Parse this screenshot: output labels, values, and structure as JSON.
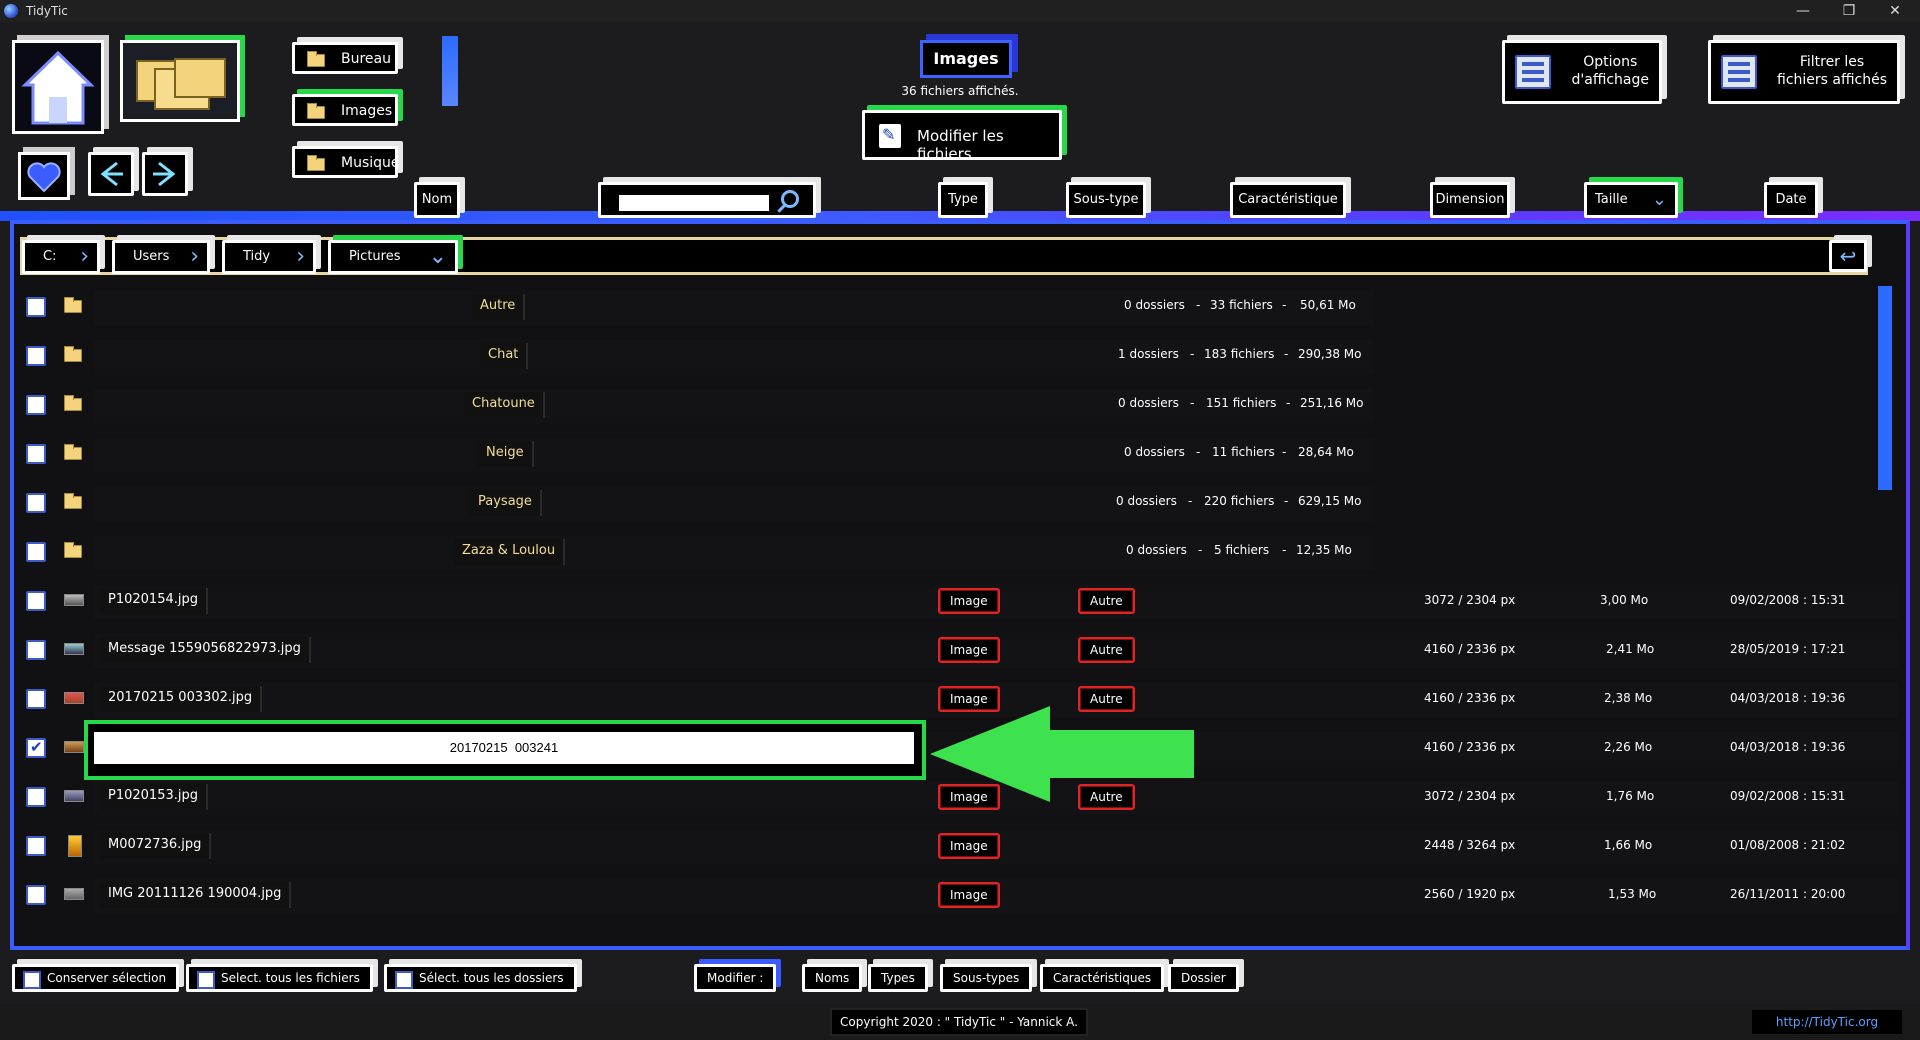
{
  "window": {
    "title": "TidyTic",
    "minimize": "—",
    "maximize": "❐",
    "close": "✕"
  },
  "nav": {
    "locations": [
      "Bureau",
      "Images",
      "Musique"
    ]
  },
  "header": {
    "title": "Images",
    "files_count": "36 fichiers affichés.",
    "modify_files": "Modifier les fichiers",
    "options_line1": "Options",
    "options_line2": "d'affichage",
    "filter_line1": "Filtrer les",
    "filter_line2": "fichiers affichés"
  },
  "columns": {
    "nom": "Nom",
    "type": "Type",
    "sous_type": "Sous-type",
    "caracteristique": "Caractéristique",
    "dimension": "Dimension",
    "taille": "Taille",
    "date": "Date",
    "search_value": ""
  },
  "breadcrumb": [
    "C:",
    "Users",
    "Tidy",
    "Pictures"
  ],
  "folders": [
    {
      "name": "Autre",
      "dossiers": "0 dossiers",
      "fichiers": "33 fichiers",
      "taille": "50,61 Mo"
    },
    {
      "name": "Chat",
      "dossiers": "1 dossiers",
      "fichiers": "183 fichiers",
      "taille": "290,38 Mo"
    },
    {
      "name": "Chatoune",
      "dossiers": "0 dossiers",
      "fichiers": "151 fichiers",
      "taille": "251,16 Mo"
    },
    {
      "name": "Neige",
      "dossiers": "0 dossiers",
      "fichiers": "11 fichiers",
      "taille": "28,64 Mo"
    },
    {
      "name": "Paysage",
      "dossiers": "0 dossiers",
      "fichiers": "220 fichiers",
      "taille": "629,15 Mo"
    },
    {
      "name": "Zaza & Loulou",
      "dossiers": "0 dossiers",
      "fichiers": "5 fichiers",
      "taille": "12,35 Mo"
    }
  ],
  "separator": "-",
  "files": [
    {
      "name": "P1020154.jpg",
      "type": "Image",
      "subtype": "Autre",
      "dimension": "3072 / 2304 px",
      "size": "3,00 Mo",
      "date": "09/02/2008 : 15:31"
    },
    {
      "name": "Message  1559056822973.jpg",
      "type": "Image",
      "subtype": "Autre",
      "dimension": "4160 / 2336 px",
      "size": "2,41 Mo",
      "date": "28/05/2019 : 17:21"
    },
    {
      "name": "20170215  003302.jpg",
      "type": "Image",
      "subtype": "Autre",
      "dimension": "4160 / 2336 px",
      "size": "2,38 Mo",
      "date": "04/03/2018 : 19:36"
    },
    {
      "name": "",
      "type": "",
      "subtype": "",
      "dimension": "4160 / 2336 px",
      "size": "2,26 Mo",
      "date": "04/03/2018 : 19:36"
    },
    {
      "name": "P1020153.jpg",
      "type": "Image",
      "subtype": "Autre",
      "dimension": "3072 / 2304 px",
      "size": "1,76 Mo",
      "date": "09/02/2008 : 15:31"
    },
    {
      "name": "M0072736.jpg",
      "type": "Image",
      "subtype": "",
      "dimension": "2448 / 3264 px",
      "size": "1,66 Mo",
      "date": "01/08/2008 : 21:02"
    },
    {
      "name": "IMG  20111126  190004.jpg",
      "type": "Image",
      "subtype": "",
      "dimension": "2560 / 1920 px",
      "size": "1,53 Mo",
      "date": "26/11/2011 : 20:00"
    }
  ],
  "edit": {
    "value": "20170215  003241"
  },
  "bottom": {
    "keep_selection": "Conserver sélection",
    "select_all_files": "Select. tous les fichiers",
    "select_all_folders": "Sélect. tous les dossiers",
    "modify_label": "Modifier :",
    "noms": "Noms",
    "types": "Types",
    "sous_types": "Sous-types",
    "caracteristiques": "Caractéristiques",
    "dossier": "Dossier"
  },
  "footer": {
    "copyright": "Copyright 2020 : \" TidyTic \" - Yannick A.",
    "link": "http://TidyTic.org"
  },
  "colors": {
    "accent_green": "#27d84b",
    "accent_blue": "#3b5cff",
    "tag_red": "#e02424",
    "folder_text": "#f4dd98"
  },
  "icons": [
    "home-icon",
    "folders-icon",
    "heart-icon",
    "arrow-left-icon",
    "arrow-right-icon",
    "folder-icon",
    "search-icon",
    "chevron-right-icon",
    "chevron-down-icon",
    "return-icon",
    "pencil-icon",
    "checkbox-icon"
  ]
}
